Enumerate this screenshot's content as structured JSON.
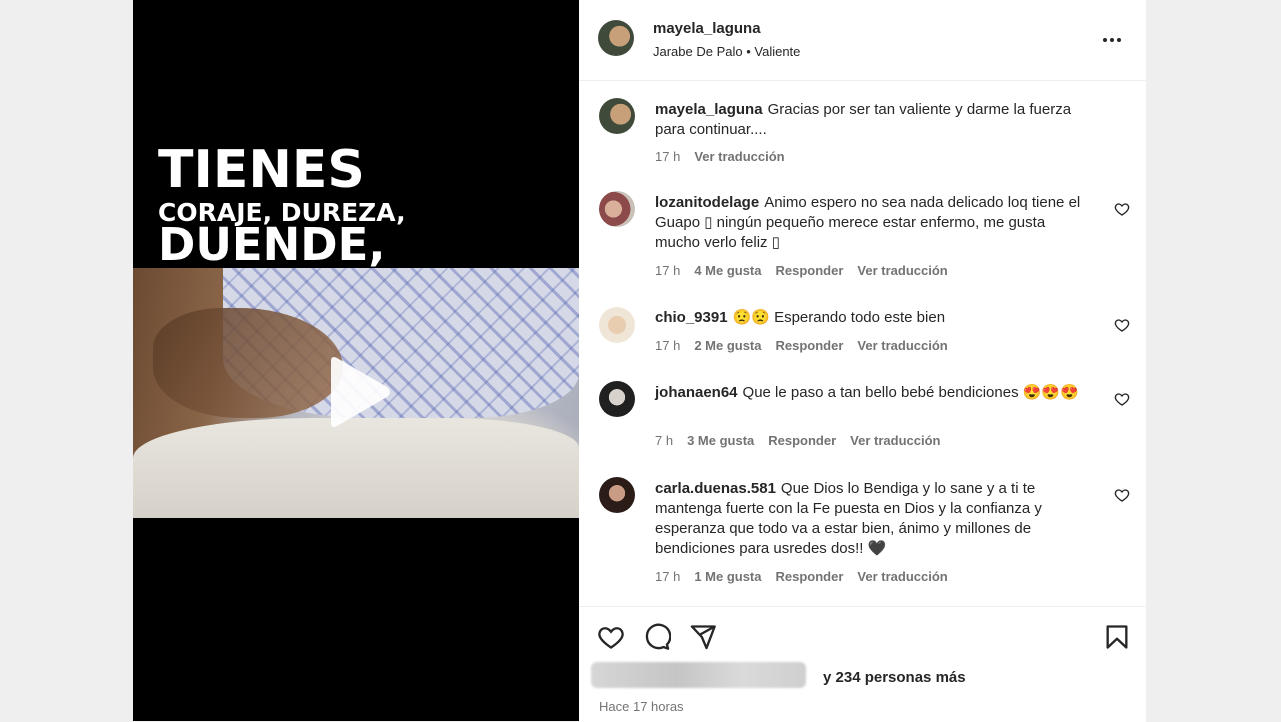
{
  "media": {
    "overlay_line1": "TIENES",
    "overlay_line2": "CORAJE, DUREZA,",
    "overlay_line3": "DUENDE,",
    "play_icon": "play-icon"
  },
  "header": {
    "username": "mayela_laguna",
    "audio": "Jarabe De Palo • Valiente",
    "more_icon": "more-horizontal-icon"
  },
  "comments": [
    {
      "username": "mayela_laguna",
      "text": "Gracias por ser tan valiente y darme la fuerza para continuar....",
      "time": "17 h",
      "likes": "",
      "reply": "",
      "translate": "Ver traducción"
    },
    {
      "username": "lozanitodelage",
      "text": "Animo espero no sea nada delicado loq tiene el Guapo ▯ ningún pequeño merece estar enfermo, me gusta mucho verlo feliz ▯",
      "time": "17 h",
      "likes": "4 Me gusta",
      "reply": "Responder",
      "translate": "Ver traducción"
    },
    {
      "username": "chio_9391",
      "text": "😟😟 Esperando todo este bien",
      "time": "17 h",
      "likes": "2 Me gusta",
      "reply": "Responder",
      "translate": "Ver traducción"
    },
    {
      "username": "johanaen64",
      "text": "Que le paso a tan bello bebé bendiciones 😍😍😍",
      "time": "7 h",
      "likes": "3 Me gusta",
      "reply": "Responder",
      "translate": "Ver traducción"
    },
    {
      "username": "carla.duenas.581",
      "text": "Que Dios lo Bendiga y lo sane y a ti te mantenga fuerte con la Fe puesta en Dios y la confianza y esperanza que todo va a estar bien, ánimo y millones de bendiciones para usredes dos!! 🖤",
      "time": "17 h",
      "likes": "1 Me gusta",
      "reply": "Responder",
      "translate": "Ver traducción"
    }
  ],
  "actions": {
    "like_icon": "heart-icon",
    "comment_icon": "comment-icon",
    "share_icon": "send-icon",
    "save_icon": "bookmark-icon"
  },
  "likes_summary": "y 234 personas más",
  "time_ago": "Hace 17 horas"
}
